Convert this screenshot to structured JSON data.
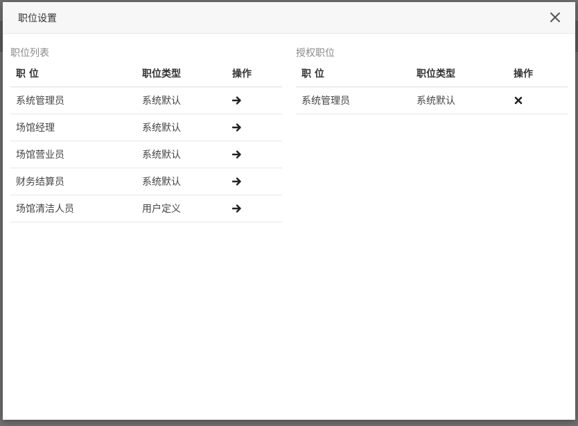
{
  "modal": {
    "title": "职位设置",
    "close_icon": "close-icon"
  },
  "position_list": {
    "title": "职位列表",
    "headers": {
      "position": "职 位",
      "type": "职位类型",
      "action": "操作"
    },
    "rows": [
      {
        "position": "系统管理员",
        "type": "系统默认",
        "action_icon": "arrow-right-icon"
      },
      {
        "position": "场馆经理",
        "type": "系统默认",
        "action_icon": "arrow-right-icon"
      },
      {
        "position": "场馆营业员",
        "type": "系统默认",
        "action_icon": "arrow-right-icon"
      },
      {
        "position": "财务结算员",
        "type": "系统默认",
        "action_icon": "arrow-right-icon"
      },
      {
        "position": "场馆清洁人员",
        "type": "用户定义",
        "action_icon": "arrow-right-icon"
      }
    ]
  },
  "authorized_positions": {
    "title": "授权职位",
    "headers": {
      "position": "职 位",
      "type": "职位类型",
      "action": "操作"
    },
    "rows": [
      {
        "position": "系统管理员",
        "type": "系统默认",
        "action_icon": "remove-icon"
      }
    ]
  },
  "colors": {
    "overlay": "#6f6f6f",
    "header_bg": "#f7f7f7",
    "text": "#333333",
    "muted": "#8a8a8a"
  }
}
